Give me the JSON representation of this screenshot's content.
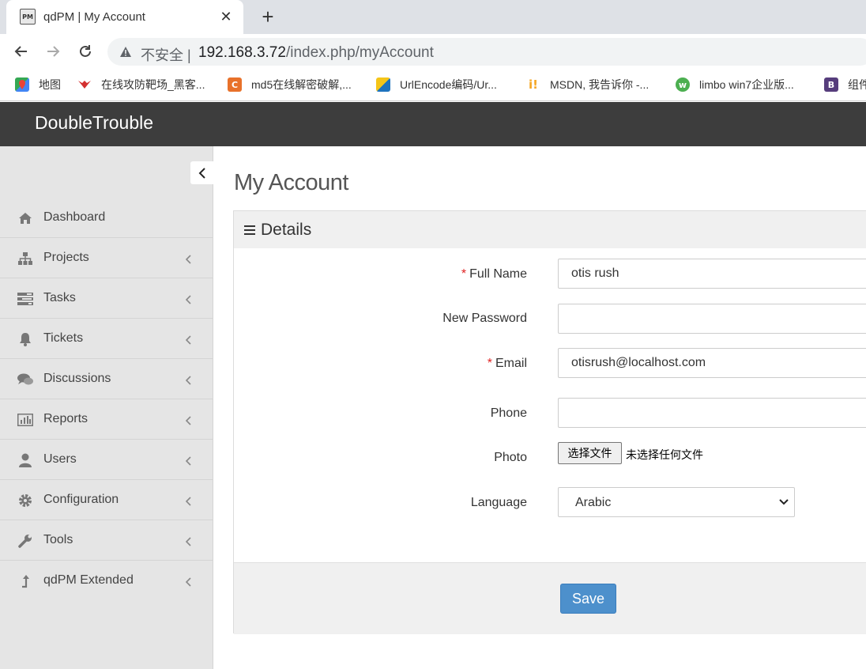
{
  "browser": {
    "tab_title": "qdPM | My Account",
    "tab_favicon_text": "PM",
    "security_label": "不安全",
    "url_host": "192.168.3.72",
    "url_path": "/index.php/myAccount",
    "bookmarks": [
      {
        "label": "地图",
        "icon": "maps-icon",
        "color": "#34a853"
      },
      {
        "label": "在线攻防靶场_黑客...",
        "icon": "red-bird-icon",
        "color": "#d32f2f"
      },
      {
        "label": "md5在线解密破解,...",
        "icon": "cmd5-icon",
        "color": "#e8712a"
      },
      {
        "label": "UrlEncode编码/Ur...",
        "icon": "urlencode-icon",
        "color": "#1e73be"
      },
      {
        "label": "MSDN, 我告诉你 -...",
        "icon": "msdn-icon",
        "color": "#f5a623"
      },
      {
        "label": "limbo win7企业版...",
        "icon": "limbo-icon",
        "color": "#4caf50"
      },
      {
        "label": "组件",
        "icon": "bootstrap-icon",
        "color": "#563d7c"
      }
    ]
  },
  "app": {
    "brand": "DoubleTrouble"
  },
  "sidebar": {
    "items": [
      {
        "label": "Dashboard",
        "icon": "home-icon",
        "has_submenu": false
      },
      {
        "label": "Projects",
        "icon": "sitemap-icon",
        "has_submenu": true
      },
      {
        "label": "Tasks",
        "icon": "tasks-icon",
        "has_submenu": true
      },
      {
        "label": "Tickets",
        "icon": "bell-icon",
        "has_submenu": true
      },
      {
        "label": "Discussions",
        "icon": "comments-icon",
        "has_submenu": true
      },
      {
        "label": "Reports",
        "icon": "bar-chart-icon",
        "has_submenu": true
      },
      {
        "label": "Users",
        "icon": "user-icon",
        "has_submenu": true
      },
      {
        "label": "Configuration",
        "icon": "gear-icon",
        "has_submenu": true
      },
      {
        "label": "Tools",
        "icon": "wrench-icon",
        "has_submenu": true
      },
      {
        "label": "qdPM Extended",
        "icon": "level-up-icon",
        "has_submenu": true
      }
    ]
  },
  "main": {
    "page_title": "My Account",
    "panel_title": "Details",
    "form": {
      "required_marker": "*",
      "full_name_label": "Full Name",
      "full_name_value": "otis rush",
      "new_password_label": "New Password",
      "new_password_value": "",
      "email_label": "Email",
      "email_value": "otisrush@localhost.com",
      "phone_label": "Phone",
      "phone_value": "",
      "photo_label": "Photo",
      "file_button_label": "选择文件",
      "file_status": "未选择任何文件",
      "language_label": "Language",
      "language_value": "Arabic"
    },
    "save_label": "Save"
  },
  "colors": {
    "header_bg": "#3d3d3d",
    "sidebar_bg": "#e5e5e5",
    "primary_button": "#4d90cc",
    "required": "#e02222"
  }
}
